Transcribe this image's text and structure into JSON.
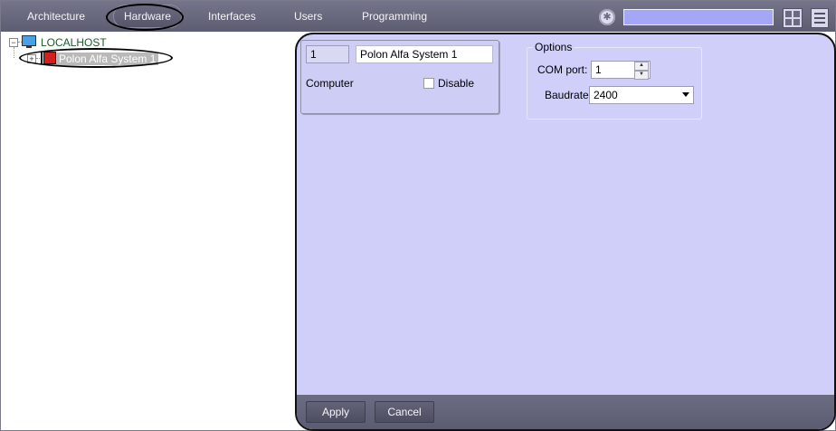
{
  "tabs": [
    {
      "label": "Architecture"
    },
    {
      "label": "Hardware"
    },
    {
      "label": "Interfaces"
    },
    {
      "label": "Users"
    },
    {
      "label": "Programming"
    }
  ],
  "search": {
    "value": ""
  },
  "tree": {
    "root": {
      "label": "LOCALHOST"
    },
    "child": {
      "label": "Polon Alfa System 1"
    }
  },
  "device": {
    "id": "1",
    "name": "Polon Alfa System 1",
    "computer_label": "Computer",
    "disable_label": "Disable",
    "disable_checked": false
  },
  "options": {
    "legend": "Options",
    "com_port_label": "COM port:",
    "com_port_value": "1",
    "baudrate_label": "Baudrate:",
    "baudrate_value": "2400"
  },
  "footer": {
    "apply_label": "Apply",
    "cancel_label": "Cancel"
  },
  "colors": {
    "accent": "#cfcff9",
    "toolbar": "#65657a",
    "search": "#a6a6f8"
  }
}
